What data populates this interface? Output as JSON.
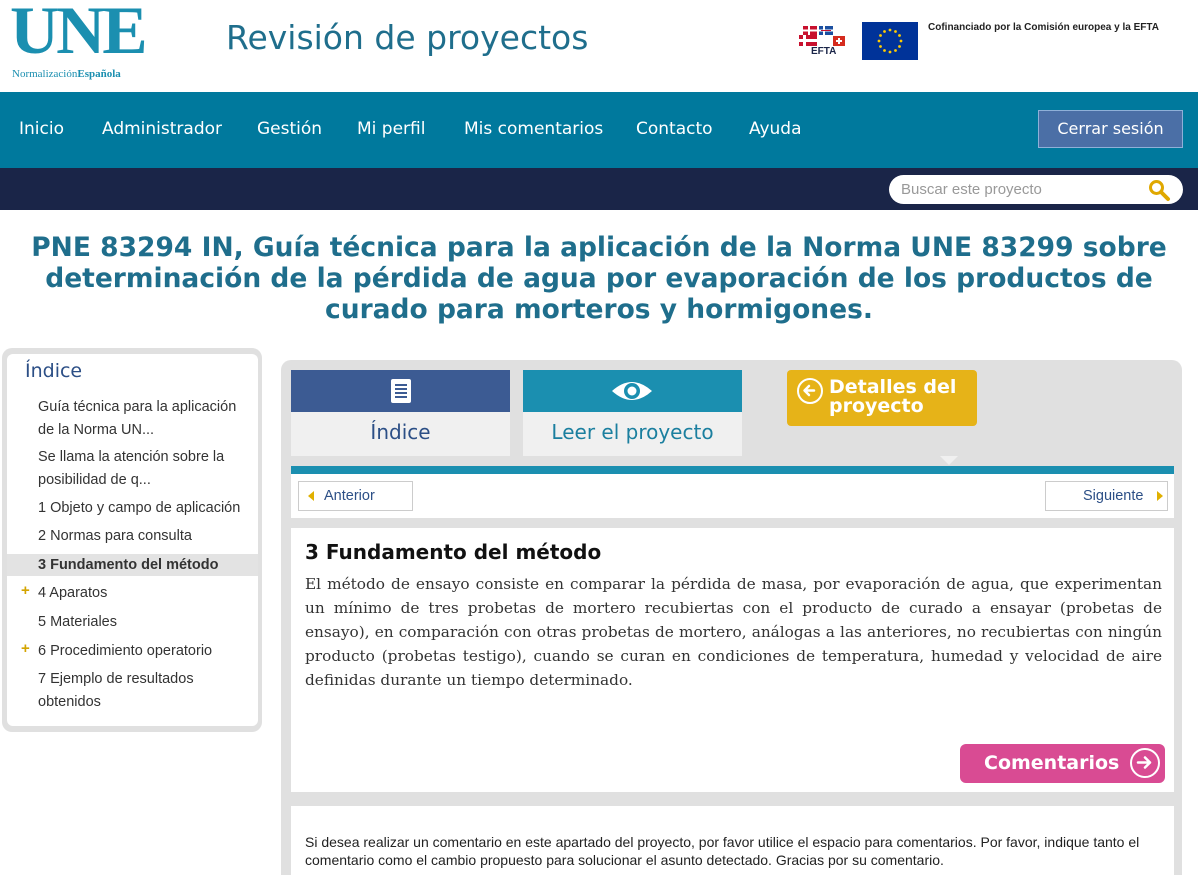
{
  "header": {
    "logo_text": "UNE",
    "logo_sub_light": "Normalización",
    "logo_sub_bold": "Española",
    "site_title": "Revisión de proyectos",
    "efta_label": "EFTA",
    "cofinance_text": "Cofinanciado por la Comisión europea y la EFTA"
  },
  "nav": {
    "items": [
      "Inicio",
      "Administrador",
      "Gestión",
      "Mi perfil",
      "Mis comentarios",
      "Contacto",
      "Ayuda"
    ],
    "logout": "Cerrar sesión"
  },
  "search": {
    "placeholder": "Buscar este proyecto"
  },
  "page_title": "PNE 83294 IN, Guía técnica para la aplicación de la Norma UNE 83299 sobre determinación de la pérdida de agua por evaporación de los productos de curado para morteros y hormigones.",
  "sidebar": {
    "title": "Índice",
    "items": [
      {
        "label": "Guía técnica para la aplicación de la Norma UN...",
        "expandable": false,
        "active": false
      },
      {
        "label": "Se llama la atención sobre la posibilidad de q...",
        "expandable": false,
        "active": false
      },
      {
        "label": "1 Objeto y campo de aplicación",
        "expandable": false,
        "active": false
      },
      {
        "label": "2 Normas para consulta",
        "expandable": false,
        "active": false
      },
      {
        "label": "3 Fundamento del método",
        "expandable": false,
        "active": true
      },
      {
        "label": "4 Aparatos",
        "expandable": true,
        "active": false
      },
      {
        "label": "5 Materiales",
        "expandable": false,
        "active": false
      },
      {
        "label": "6 Procedimiento operatorio",
        "expandable": true,
        "active": false
      },
      {
        "label": "7 Ejemplo de resultados obtenidos",
        "expandable": false,
        "active": false
      }
    ],
    "plus_symbol": "+"
  },
  "tabs": {
    "index_label": "Índice",
    "read_label": "Leer el proyecto",
    "details_label": "Detalles del proyecto"
  },
  "pager": {
    "prev": "Anterior",
    "next": "Siguiente"
  },
  "content": {
    "title": "3 Fundamento del método",
    "body": "El método de ensayo consiste en comparar la pérdida de masa, por evaporación de agua, que experimentan un mínimo de tres probetas de mortero recubiertas con el producto de curado a ensayar (probetas de ensayo), en comparación con otras probetas de mortero, análogas a las anteriores, no recubiertas con ningún producto (probetas testigo), cuando se curan en condiciones de temperatura, humedad y velocidad de aire definidas durante un tiempo determinado.",
    "comments_button": "Comentarios"
  },
  "note": "Si desea realizar un comentario en este apartado del proyecto, por favor utilice el espacio para comentarios. Por favor, indique tanto el comentario como el cambio propuesto para solucionar el asunto detectado. Gracias por su comentario.",
  "colors": {
    "brand_teal": "#00799d",
    "dark_nav": "#1a2548",
    "title_blue": "#1f6e8c",
    "details_gold": "#e6b318",
    "comments_pink": "#d94b93",
    "logout_blue": "#4b6fa6"
  },
  "icons": {
    "index_tab": "list-document-icon",
    "read_tab": "eye-icon",
    "details": "arrow-left-circle-icon",
    "comments": "arrow-right-circle-icon",
    "search": "magnifier-icon"
  }
}
